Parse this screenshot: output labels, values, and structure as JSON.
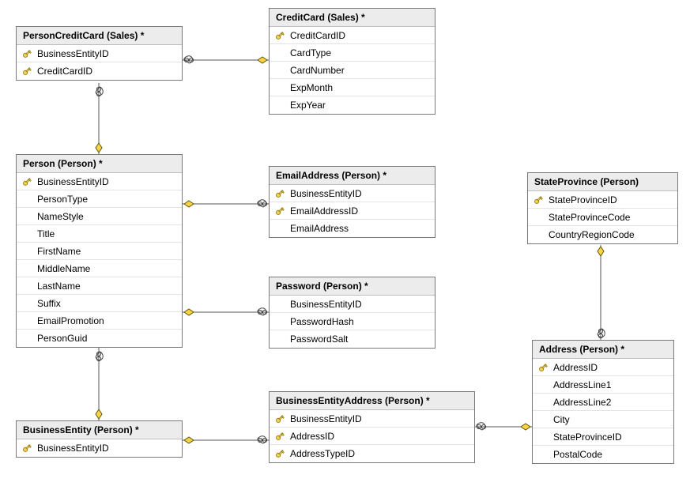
{
  "tables": {
    "person_creditcard": {
      "title": "PersonCreditCard (Sales) *",
      "columns": [
        {
          "name": "BusinessEntityID",
          "pk": true
        },
        {
          "name": "CreditCardID",
          "pk": true
        }
      ]
    },
    "creditcard": {
      "title": "CreditCard (Sales) *",
      "columns": [
        {
          "name": "CreditCardID",
          "pk": true
        },
        {
          "name": "CardType",
          "pk": false
        },
        {
          "name": "CardNumber",
          "pk": false
        },
        {
          "name": "ExpMonth",
          "pk": false
        },
        {
          "name": "ExpYear",
          "pk": false
        }
      ]
    },
    "person": {
      "title": "Person (Person) *",
      "columns": [
        {
          "name": "BusinessEntityID",
          "pk": true
        },
        {
          "name": "PersonType",
          "pk": false
        },
        {
          "name": "NameStyle",
          "pk": false
        },
        {
          "name": "Title",
          "pk": false
        },
        {
          "name": "FirstName",
          "pk": false
        },
        {
          "name": "MiddleName",
          "pk": false
        },
        {
          "name": "LastName",
          "pk": false
        },
        {
          "name": "Suffix",
          "pk": false
        },
        {
          "name": "EmailPromotion",
          "pk": false
        },
        {
          "name": "PersonGuid",
          "pk": false
        }
      ]
    },
    "emailaddress": {
      "title": "EmailAddress (Person) *",
      "columns": [
        {
          "name": "BusinessEntityID",
          "pk": true
        },
        {
          "name": "EmailAddressID",
          "pk": true
        },
        {
          "name": "EmailAddress",
          "pk": false
        }
      ]
    },
    "stateprovince": {
      "title": "StateProvince (Person)",
      "columns": [
        {
          "name": "StateProvinceID",
          "pk": true
        },
        {
          "name": "StateProvinceCode",
          "pk": false
        },
        {
          "name": "CountryRegionCode",
          "pk": false
        }
      ]
    },
    "password": {
      "title": "Password (Person) *",
      "columns": [
        {
          "name": "BusinessEntityID",
          "pk": false
        },
        {
          "name": "PasswordHash",
          "pk": false
        },
        {
          "name": "PasswordSalt",
          "pk": false
        }
      ]
    },
    "address": {
      "title": "Address (Person) *",
      "columns": [
        {
          "name": "AddressID",
          "pk": true
        },
        {
          "name": "AddressLine1",
          "pk": false
        },
        {
          "name": "AddressLine2",
          "pk": false
        },
        {
          "name": "City",
          "pk": false
        },
        {
          "name": "StateProvinceID",
          "pk": false
        },
        {
          "name": "PostalCode",
          "pk": false
        }
      ]
    },
    "business_entity_address": {
      "title": "BusinessEntityAddress (Person) *",
      "columns": [
        {
          "name": "BusinessEntityID",
          "pk": true
        },
        {
          "name": "AddressID",
          "pk": true
        },
        {
          "name": "AddressTypeID",
          "pk": true
        }
      ]
    },
    "business_entity": {
      "title": "BusinessEntity (Person) *",
      "columns": [
        {
          "name": "BusinessEntityID",
          "pk": true
        }
      ]
    }
  },
  "relationships": [
    {
      "from": "person_creditcard",
      "to": "creditcard"
    },
    {
      "from": "person_creditcard",
      "to": "person"
    },
    {
      "from": "person",
      "to": "emailaddress"
    },
    {
      "from": "person",
      "to": "password"
    },
    {
      "from": "person",
      "to": "business_entity"
    },
    {
      "from": "business_entity",
      "to": "business_entity_address"
    },
    {
      "from": "business_entity_address",
      "to": "address"
    },
    {
      "from": "address",
      "to": "stateprovince"
    }
  ]
}
